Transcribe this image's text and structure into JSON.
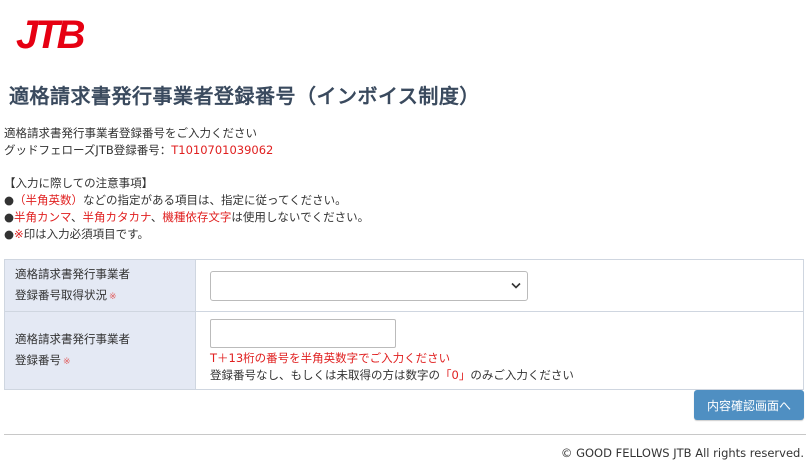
{
  "logo": {
    "text": "JTB",
    "color": "#e60012"
  },
  "page": {
    "title": "適格請求書発行事業者登録番号（インボイス制度）"
  },
  "intro": {
    "line1": "適格請求書発行事業者登録番号をご入力ください",
    "reg_label": "グッドフェローズJTB登録番号：",
    "reg_number": "T1010701039062"
  },
  "notes": {
    "heading": "【入力に際しての注意事項】",
    "n1_bullet": "●",
    "n1_red": "（半角英数）",
    "n1_rest": "などの指定がある項目は、指定に従ってください。",
    "n2_bullet": "●",
    "n2_red1": "半角カンマ",
    "n2_sep1": "、",
    "n2_red2": "半角カタカナ",
    "n2_sep2": "、",
    "n2_red3": "機種依存文字",
    "n2_rest": "は使用しないでください。",
    "n3_bullet": "●",
    "n3_red": "※",
    "n3_rest": "印は入力必須項目です。"
  },
  "form": {
    "status_label_line1": "適格請求書発行事業者",
    "status_label_line2": "登録番号取得状況",
    "status_required": "※",
    "status_selected": "",
    "number_label_line1": "適格請求書発行事業者",
    "number_label_line2": "登録番号",
    "number_required": "※",
    "number_value": "",
    "number_hint_red": "T＋13桁の番号を半角英数字でご入力ください",
    "number_hint_pre": "登録番号なし、もしくは未取得の方は数字の",
    "number_hint_zero": "「0」",
    "number_hint_post": "のみご入力ください"
  },
  "actions": {
    "confirm_label": "内容確認画面へ"
  },
  "footer": {
    "copyright": "© GOOD FELLOWS JTB All rights reserved."
  },
  "colors": {
    "accent_red": "#e02020",
    "button_blue": "#4f8fc2",
    "label_bg": "#e4e9f4",
    "title": "#3a4a5e"
  }
}
